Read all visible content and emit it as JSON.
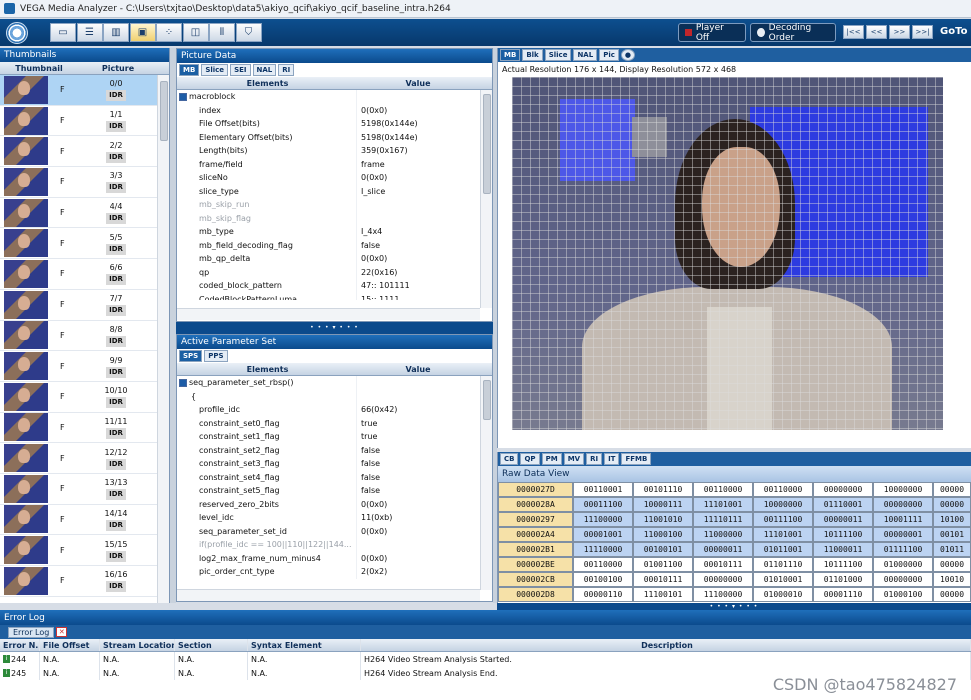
{
  "window": {
    "title": "VEGA Media Analyzer - C:\\Users\\txjtao\\Desktop\\data5\\akiyo_qcif\\akiyo_qcif_baseline_intra.h264"
  },
  "toolbar": {
    "icons": [
      "stream-view-icon",
      "list-view-icon",
      "bar-chart-icon",
      "frame-view-icon",
      "grid-view-icon",
      "split-view-icon",
      "waveform-icon",
      "filter-icon"
    ],
    "player_label": "Player Off",
    "decoding_label": "Decoding Order",
    "nav": [
      "|<<",
      "<<",
      ">>",
      ">>|"
    ],
    "goto_label": "GoTo"
  },
  "thumbnails": {
    "title": "Thumbnails",
    "col_thumb": "Thumbnail",
    "col_picture": "Picture",
    "rows": [
      {
        "type": "F",
        "num": "0/0",
        "badge": "IDR"
      },
      {
        "type": "F",
        "num": "1/1",
        "badge": "IDR"
      },
      {
        "type": "F",
        "num": "2/2",
        "badge": "IDR"
      },
      {
        "type": "F",
        "num": "3/3",
        "badge": "IDR"
      },
      {
        "type": "F",
        "num": "4/4",
        "badge": "IDR"
      },
      {
        "type": "F",
        "num": "5/5",
        "badge": "IDR"
      },
      {
        "type": "F",
        "num": "6/6",
        "badge": "IDR"
      },
      {
        "type": "F",
        "num": "7/7",
        "badge": "IDR"
      },
      {
        "type": "F",
        "num": "8/8",
        "badge": "IDR"
      },
      {
        "type": "F",
        "num": "9/9",
        "badge": "IDR"
      },
      {
        "type": "F",
        "num": "10/10",
        "badge": "IDR"
      },
      {
        "type": "F",
        "num": "11/11",
        "badge": "IDR"
      },
      {
        "type": "F",
        "num": "12/12",
        "badge": "IDR"
      },
      {
        "type": "F",
        "num": "13/13",
        "badge": "IDR"
      },
      {
        "type": "F",
        "num": "14/14",
        "badge": "IDR"
      },
      {
        "type": "F",
        "num": "15/15",
        "badge": "IDR"
      },
      {
        "type": "F",
        "num": "16/16",
        "badge": "IDR"
      }
    ]
  },
  "picture_data": {
    "title": "Picture Data",
    "tabs": [
      "MB",
      "Slice",
      "SEI",
      "NAL",
      "RI"
    ],
    "col_elements": "Elements",
    "col_value": "Value",
    "root": "macroblock",
    "rows": [
      {
        "k": "index",
        "v": "0(0x0)",
        "dim": false
      },
      {
        "k": "File Offset(bits)",
        "v": "5198(0x144e)",
        "dim": false
      },
      {
        "k": "Elementary Offset(bits)",
        "v": "5198(0x144e)",
        "dim": false
      },
      {
        "k": "Length(bits)",
        "v": "359(0x167)",
        "dim": false
      },
      {
        "k": "frame/field",
        "v": "frame",
        "dim": false
      },
      {
        "k": "sliceNo",
        "v": "0(0x0)",
        "dim": false
      },
      {
        "k": "slice_type",
        "v": "I_slice",
        "dim": false
      },
      {
        "k": "mb_skip_run",
        "v": "",
        "dim": true
      },
      {
        "k": "mb_skip_flag",
        "v": "",
        "dim": true
      },
      {
        "k": "mb_type",
        "v": "I_4x4",
        "dim": false
      },
      {
        "k": "mb_field_decoding_flag",
        "v": "false",
        "dim": false
      },
      {
        "k": "mb_qp_delta",
        "v": "0(0x0)",
        "dim": false
      },
      {
        "k": "qp",
        "v": "22(0x16)",
        "dim": false
      },
      {
        "k": "coded_block_pattern",
        "v": "47:: 101111",
        "dim": false
      },
      {
        "k": "CodedBlockPatternLuma",
        "v": "15:: 1111",
        "dim": false
      }
    ]
  },
  "param_set": {
    "title": "Active Parameter Set",
    "tabs": [
      "SPS",
      "PPS"
    ],
    "col_elements": "Elements",
    "col_value": "Value",
    "root": "seq_parameter_set_rbsp()",
    "brace": "{",
    "rows": [
      {
        "k": "profile_idc",
        "v": "66(0x42)",
        "dim": false
      },
      {
        "k": "constraint_set0_flag",
        "v": "true",
        "dim": false
      },
      {
        "k": "constraint_set1_flag",
        "v": "true",
        "dim": false
      },
      {
        "k": "constraint_set2_flag",
        "v": "false",
        "dim": false
      },
      {
        "k": "constraint_set3_flag",
        "v": "false",
        "dim": false
      },
      {
        "k": "constraint_set4_flag",
        "v": "false",
        "dim": false
      },
      {
        "k": "constraint_set5_flag",
        "v": "false",
        "dim": false
      },
      {
        "k": "reserved_zero_2bits",
        "v": "0(0x0)",
        "dim": false
      },
      {
        "k": "level_idc",
        "v": "11(0xb)",
        "dim": false
      },
      {
        "k": "seq_parameter_set_id",
        "v": "0(0x0)",
        "dim": false
      },
      {
        "k": "if(profile_idc == 100||110||122||144...",
        "v": "",
        "dim": true
      },
      {
        "k": "log2_max_frame_num_minus4",
        "v": "0(0x0)",
        "dim": false
      },
      {
        "k": "pic_order_cnt_type",
        "v": "2(0x2)",
        "dim": false
      }
    ]
  },
  "viewer": {
    "tabs": [
      "MB",
      "Blk",
      "Slice",
      "NAL",
      "Pic"
    ],
    "resolution_text": "Actual Resolution 176 x 144, Display Resolution 572 x 468"
  },
  "raw": {
    "tabs": [
      "CB",
      "QP",
      "PM",
      "MV",
      "RI",
      "IT",
      "FFMB"
    ],
    "title": "Raw Data View",
    "rows": [
      {
        "addr": "0000027D",
        "hl": false,
        "cells": [
          "00110001",
          "00101110",
          "00110000",
          "00110000",
          "00000000",
          "10000000",
          "00000"
        ]
      },
      {
        "addr": "0000028A",
        "hl": true,
        "cells": [
          "00011100",
          "10000111",
          "11101001",
          "10000000",
          "01110001",
          "00000000",
          "00000"
        ]
      },
      {
        "addr": "00000297",
        "hl": true,
        "cells": [
          "11100000",
          "11001010",
          "11110111",
          "00111100",
          "00000011",
          "10001111",
          "10100"
        ]
      },
      {
        "addr": "000002A4",
        "hl": true,
        "cells": [
          "00001001",
          "11000100",
          "11000000",
          "11101001",
          "10111100",
          "00000001",
          "00101"
        ]
      },
      {
        "addr": "000002B1",
        "hl": true,
        "cells": [
          "11110000",
          "00100101",
          "00000011",
          "01011001",
          "11000011",
          "01111100",
          "01011"
        ]
      },
      {
        "addr": "000002BE",
        "hl": false,
        "cells": [
          "00110000",
          "01001100",
          "00010111",
          "01101110",
          "10111100",
          "01000000",
          "00000"
        ]
      },
      {
        "addr": "000002CB",
        "hl": false,
        "cells": [
          "00100100",
          "00010111",
          "00000000",
          "01010001",
          "01101000",
          "00000000",
          "10010"
        ]
      },
      {
        "addr": "000002D8",
        "hl": false,
        "cells": [
          "00000110",
          "11100101",
          "11100000",
          "01000010",
          "00001110",
          "01000100",
          "00000"
        ]
      }
    ]
  },
  "error_log": {
    "title": "Error Log",
    "tab": "Error Log",
    "columns": [
      "Error N...",
      "File Offset",
      "Stream Location",
      "Section",
      "Syntax Element",
      "Description"
    ],
    "rows": [
      {
        "n": "244",
        "off": "N.A.",
        "loc": "N.A.",
        "sec": "N.A.",
        "syn": "N.A.",
        "desc": "H264 Video Stream Analysis Started."
      },
      {
        "n": "245",
        "off": "N.A.",
        "loc": "N.A.",
        "sec": "N.A.",
        "syn": "N.A.",
        "desc": "H264 Video Stream Analysis End."
      }
    ]
  },
  "watermark": "CSDN @tao475824827"
}
